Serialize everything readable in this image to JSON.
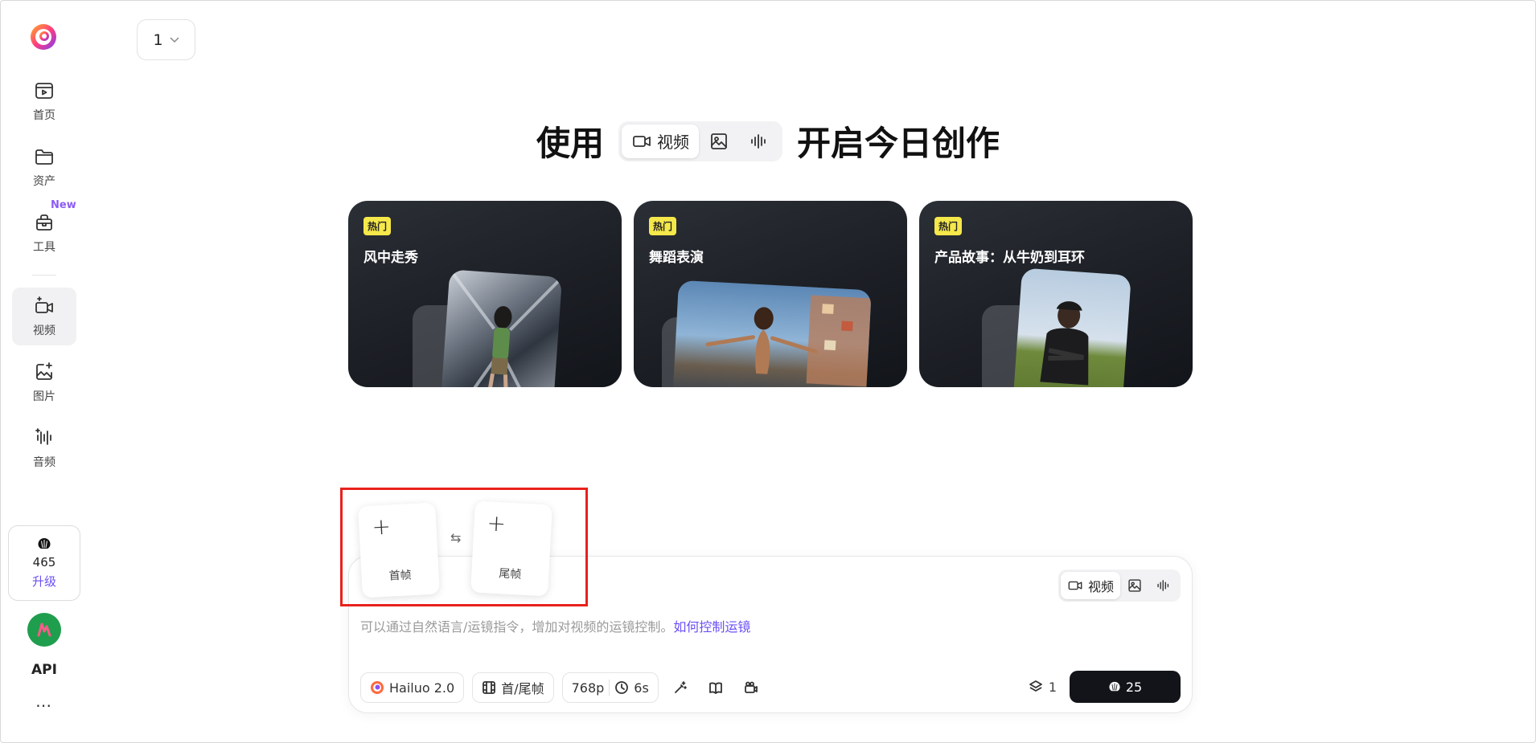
{
  "nav": {
    "items": [
      {
        "label": "首页",
        "icon": "home-video-icon"
      },
      {
        "label": "资产",
        "icon": "folder-icon"
      },
      {
        "label": "工具",
        "icon": "toolbox-icon",
        "badge": "New"
      },
      {
        "label": "视频",
        "icon": "video-sparkle-icon",
        "active": true
      },
      {
        "label": "图片",
        "icon": "image-sparkle-icon"
      },
      {
        "label": "音频",
        "icon": "audio-sparkle-icon"
      }
    ],
    "credits": "465",
    "upgrade": "升级",
    "api": "API",
    "more": "⋯"
  },
  "top_select": {
    "value": "1"
  },
  "headline": {
    "prefix": "使用",
    "suffix": "开启今日创作",
    "modes": [
      {
        "label": "视频",
        "active": true
      },
      {
        "label": ""
      },
      {
        "label": ""
      }
    ]
  },
  "cards": [
    {
      "tag": "热门",
      "title": "风中走秀"
    },
    {
      "tag": "热门",
      "title": "舞蹈表演"
    },
    {
      "tag": "热门",
      "title": "产品故事：从牛奶到耳环"
    }
  ],
  "frames": {
    "first_plus": "+",
    "first_label": "首帧",
    "last_plus": "+",
    "last_label": "尾帧",
    "swap_symbol": "⇆"
  },
  "composer": {
    "mode_label": "视频",
    "placeholder": "可以通过自然语言/运镜指令，增加对视频的运镜控制。",
    "help_link": "如何控制运镜",
    "model": "Hailuo 2.0",
    "frame_mode": "首/尾帧",
    "resolution": "768p",
    "duration": "6s",
    "count": "1",
    "generate_cost": "25"
  },
  "colors": {
    "accent": "#6b4ff6",
    "hot_tag": "#f5e84a",
    "highlight_box": "#e8211c",
    "generate_button": "#121419"
  }
}
